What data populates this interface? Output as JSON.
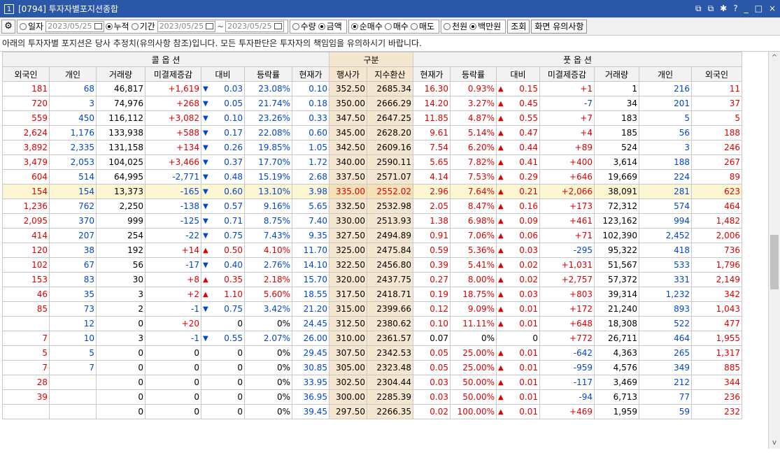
{
  "window": {
    "num": "1",
    "title": "[0794] 투자자별포지션종합",
    "ctrl_min": "_",
    "ctrl_max": "□",
    "ctrl_close": "×",
    "ctrl_help": "?",
    "ctrl_a": "⧉",
    "ctrl_b": "⧉",
    "ctrl_c": "✱"
  },
  "toolbar": {
    "period": [
      {
        "label": "일자",
        "on": false
      },
      {
        "label": "누적",
        "on": true
      },
      {
        "label": "기간",
        "on": false
      }
    ],
    "date1": "2023/05/25",
    "date2": "2023/05/25",
    "date3": "2023/05/25",
    "tilde": "~",
    "unit": [
      {
        "label": "수량",
        "on": false
      },
      {
        "label": "금액",
        "on": true
      }
    ],
    "trade": [
      {
        "label": "순매수",
        "on": true
      },
      {
        "label": "매수",
        "on": false
      },
      {
        "label": "매도",
        "on": false
      }
    ],
    "money": [
      {
        "label": "천원",
        "on": false
      },
      {
        "label": "백만원",
        "on": true
      }
    ],
    "query": "조회",
    "notes": "화면 유의사항"
  },
  "notice": "아래의 투자자별 포지션은 당사 추정치(유의사항 참조)입니다. 모든 투자판단은 투자자의 책임임을 유의하시기 바랍니다.",
  "header": {
    "call": "콜 옵 션",
    "mid": "구분",
    "put": "풋 옵 션",
    "cols": [
      "외국인",
      "개인",
      "거래량",
      "미결제증감",
      "대비",
      "등락률",
      "현재가",
      "행사가",
      "지수환산",
      "현재가",
      "등락률",
      "대비",
      "미결제증감",
      "거래량",
      "개인",
      "외국인"
    ]
  },
  "colors": {
    "up": "#e00000",
    "down": "#0046d5"
  },
  "rows": [
    [
      "181",
      "68",
      "46,817",
      "+1,619",
      "0.03",
      "23.08%",
      "0.10",
      "352.50",
      "2685.34",
      "16.30",
      "0.93%",
      "0.15",
      "+1",
      "1",
      "216",
      "11"
    ],
    [
      "720",
      "3",
      "74,976",
      "+268",
      "0.05",
      "21.74%",
      "0.18",
      "350.00",
      "2666.29",
      "14.20",
      "3.27%",
      "0.45",
      "-7",
      "34",
      "201",
      "37"
    ],
    [
      "559",
      "450",
      "116,112",
      "+3,082",
      "0.10",
      "23.26%",
      "0.33",
      "347.50",
      "2647.25",
      "11.85",
      "4.87%",
      "0.55",
      "+7",
      "183",
      "5",
      "5"
    ],
    [
      "2,624",
      "1,176",
      "133,938",
      "+588",
      "0.17",
      "22.08%",
      "0.60",
      "345.00",
      "2628.20",
      "9.61",
      "5.14%",
      "0.47",
      "+4",
      "185",
      "56",
      "188"
    ],
    [
      "3,892",
      "2,335",
      "131,158",
      "+134",
      "0.26",
      "19.85%",
      "1.05",
      "342.50",
      "2609.16",
      "7.54",
      "6.20%",
      "0.44",
      "+89",
      "524",
      "3",
      "246"
    ],
    [
      "3,479",
      "2,053",
      "104,025",
      "+3,466",
      "0.37",
      "17.70%",
      "1.72",
      "340.00",
      "2590.11",
      "5.65",
      "7.82%",
      "0.41",
      "+400",
      "3,614",
      "188",
      "267"
    ],
    [
      "604",
      "514",
      "64,995",
      "-2,771",
      "0.48",
      "15.19%",
      "2.68",
      "337.50",
      "2571.07",
      "4.14",
      "7.53%",
      "0.29",
      "+646",
      "19,669",
      "224",
      "89"
    ],
    [
      "154",
      "154",
      "13,373",
      "-165",
      "0.60",
      "13.10%",
      "3.98",
      "335.00",
      "2552.02",
      "2.96",
      "7.64%",
      "0.21",
      "+2,066",
      "38,091",
      "281",
      "623"
    ],
    [
      "1,236",
      "762",
      "2,250",
      "-138",
      "0.57",
      "9.16%",
      "5.65",
      "332.50",
      "2532.98",
      "2.05",
      "8.47%",
      "0.16",
      "+173",
      "72,312",
      "574",
      "464"
    ],
    [
      "2,095",
      "370",
      "999",
      "-125",
      "0.71",
      "8.75%",
      "7.40",
      "330.00",
      "2513.93",
      "1.38",
      "6.98%",
      "0.09",
      "+461",
      "123,162",
      "994",
      "1,482"
    ],
    [
      "414",
      "207",
      "254",
      "-22",
      "0.75",
      "7.43%",
      "9.35",
      "327.50",
      "2494.89",
      "0.91",
      "7.06%",
      "0.06",
      "+71",
      "102,390",
      "2,452",
      "2,006"
    ],
    [
      "120",
      "38",
      "192",
      "+14",
      "0.50",
      "4.10%",
      "11.70",
      "325.00",
      "2475.84",
      "0.59",
      "5.36%",
      "0.03",
      "-295",
      "95,322",
      "418",
      "736"
    ],
    [
      "102",
      "67",
      "56",
      "-17",
      "0.40",
      "2.76%",
      "14.10",
      "322.50",
      "2456.80",
      "0.39",
      "5.41%",
      "0.02",
      "+1,031",
      "51,567",
      "533",
      "1,796"
    ],
    [
      "153",
      "83",
      "30",
      "+8",
      "0.35",
      "2.18%",
      "15.70",
      "320.00",
      "2437.75",
      "0.27",
      "8.00%",
      "0.02",
      "+2,757",
      "57,372",
      "331",
      "2,149"
    ],
    [
      "46",
      "35",
      "3",
      "+2",
      "1.10",
      "5.60%",
      "18.55",
      "317.50",
      "2418.71",
      "0.19",
      "18.75%",
      "0.03",
      "+803",
      "39,314",
      "1,232",
      "342"
    ],
    [
      "85",
      "73",
      "2",
      "-1",
      "0.75",
      "3.42%",
      "21.20",
      "315.00",
      "2399.66",
      "0.12",
      "9.09%",
      "0.01",
      "+172",
      "21,240",
      "893",
      "1,043"
    ],
    [
      "",
      "12",
      "0",
      "+20",
      "0",
      "0%",
      "24.45",
      "312.50",
      "2380.62",
      "0.10",
      "11.11%",
      "0.01",
      "+648",
      "18,308",
      "522",
      "477"
    ],
    [
      "7",
      "10",
      "3",
      "-1",
      "0.55",
      "2.07%",
      "26.00",
      "310.00",
      "2361.57",
      "0.07",
      "0%",
      "0",
      "+772",
      "26,711",
      "464",
      "1,955"
    ],
    [
      "5",
      "5",
      "0",
      "0",
      "0",
      "0%",
      "29.45",
      "307.50",
      "2342.53",
      "0.05",
      "25.00%",
      "0.01",
      "-642",
      "4,363",
      "265",
      "1,317"
    ],
    [
      "7",
      "7",
      "0",
      "0",
      "0",
      "0%",
      "30.85",
      "305.00",
      "2323.48",
      "0.05",
      "25.00%",
      "0.01",
      "-959",
      "4,576",
      "349",
      "885"
    ],
    [
      "28",
      "",
      "0",
      "0",
      "0",
      "0%",
      "33.95",
      "302.50",
      "2304.44",
      "0.03",
      "50.00%",
      "0.01",
      "-117",
      "3,469",
      "212",
      "344"
    ],
    [
      "39",
      "",
      "0",
      "0",
      "0",
      "0%",
      "36.95",
      "300.00",
      "2285.39",
      "0.03",
      "50.00%",
      "0.01",
      "-94",
      "6,713",
      "77",
      "236"
    ],
    [
      "",
      "",
      "0",
      "0",
      "0",
      "0%",
      "39.45",
      "297.50",
      "2266.35",
      "0.02",
      "100.00%",
      "0.01",
      "+469",
      "1,959",
      "59",
      "232"
    ]
  ],
  "call_dir": [
    "down",
    "down",
    "down",
    "down",
    "down",
    "down",
    "down",
    "down",
    "down",
    "down",
    "down",
    "up",
    "down",
    "up",
    "up",
    "down",
    "",
    "down",
    "",
    "",
    "",
    "",
    ""
  ],
  "put_dir": [
    "up",
    "up",
    "up",
    "up",
    "up",
    "up",
    "up",
    "up",
    "up",
    "up",
    "up",
    "up",
    "up",
    "up",
    "up",
    "up",
    "up",
    "",
    "up",
    "up",
    "up",
    "up",
    "up"
  ],
  "highlight_row": 7,
  "scroll": {
    "up": "^",
    "down": "v"
  }
}
